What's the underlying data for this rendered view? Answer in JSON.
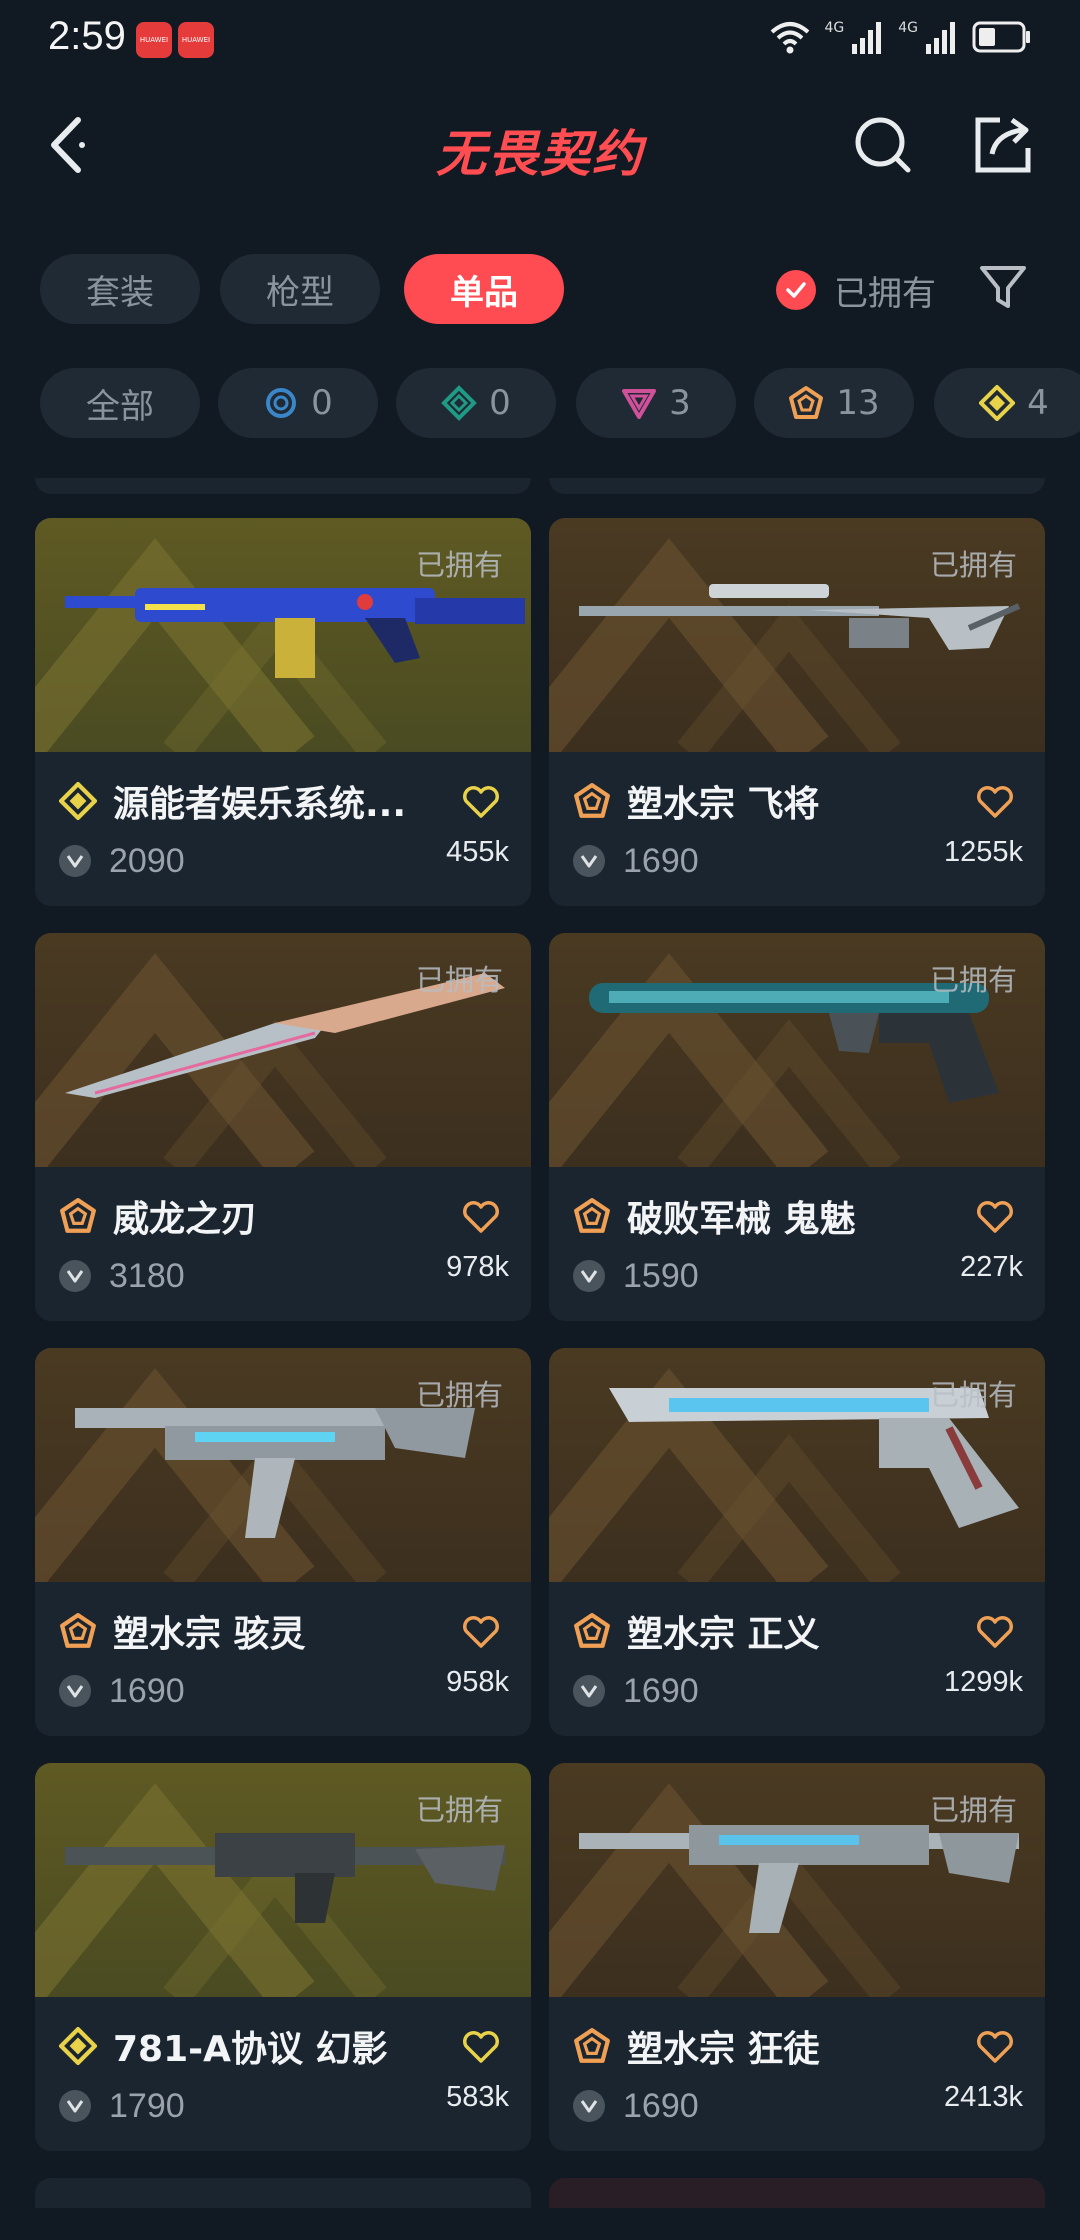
{
  "status": {
    "time": "2:59",
    "badges": [
      "HUAWEI",
      "HUAWEI"
    ],
    "network1": "4G",
    "network2": "4G"
  },
  "header": {
    "title": "无畏契约"
  },
  "tabs": [
    {
      "label": "套装",
      "active": false
    },
    {
      "label": "枪型",
      "active": false
    },
    {
      "label": "单品",
      "active": true
    }
  ],
  "owned_filter": {
    "label": "已拥有",
    "checked": true
  },
  "rarity_chips": [
    {
      "label": "全部",
      "icon": "",
      "count": ""
    },
    {
      "label": "",
      "icon": "select-tier-icon",
      "count": "0",
      "color": "#3a86c8"
    },
    {
      "label": "",
      "icon": "deluxe-tier-icon",
      "count": "0",
      "color": "#1f9a85"
    },
    {
      "label": "",
      "icon": "premium-tier-icon",
      "count": "3",
      "color": "#d0509a"
    },
    {
      "label": "",
      "icon": "exclusive-tier-icon",
      "count": "13",
      "color": "#f0a055"
    },
    {
      "label": "",
      "icon": "ultra-tier-icon",
      "count": "4",
      "color": "#e8d24a"
    }
  ],
  "colors": {
    "accent": "#ff4b52",
    "heart_gold": "#e8d24a",
    "heart_bronze": "#f0a055"
  },
  "items": [
    {
      "name": "源能者娱乐系统...",
      "owned_label": "已拥有",
      "price": "2090",
      "likes": "455k",
      "tier": "ultra",
      "weapon": "rifle-blue"
    },
    {
      "name": "塑水宗 飞将",
      "owned_label": "已拥有",
      "price": "1690",
      "likes": "1255k",
      "tier": "exclusive",
      "weapon": "sniper"
    },
    {
      "name": "威龙之刃",
      "owned_label": "已拥有",
      "price": "3180",
      "likes": "978k",
      "tier": "exclusive",
      "weapon": "knife"
    },
    {
      "name": "破败军械 鬼魅",
      "owned_label": "已拥有",
      "price": "1590",
      "likes": "227k",
      "tier": "exclusive",
      "weapon": "pistol-teal"
    },
    {
      "name": "塑水宗 骇灵",
      "owned_label": "已拥有",
      "price": "1690",
      "likes": "958k",
      "tier": "exclusive",
      "weapon": "smg"
    },
    {
      "name": "塑水宗 正义",
      "owned_label": "已拥有",
      "price": "1690",
      "likes": "1299k",
      "tier": "exclusive",
      "weapon": "pistol-chrome"
    },
    {
      "name": "781-A协议 幻影",
      "owned_label": "已拥有",
      "price": "1790",
      "likes": "583k",
      "tier": "ultra",
      "weapon": "rifle-gray"
    },
    {
      "name": "塑水宗 狂徒",
      "owned_label": "已拥有",
      "price": "1690",
      "likes": "2413k",
      "tier": "exclusive",
      "weapon": "rifle-chrome"
    }
  ]
}
